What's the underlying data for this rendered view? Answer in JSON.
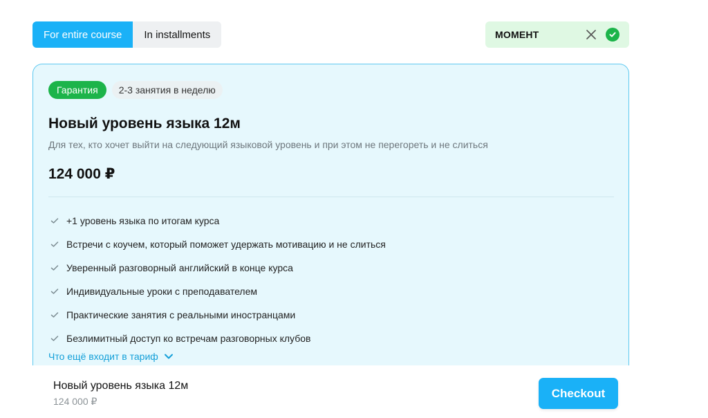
{
  "payment_toggle": {
    "options": [
      "For entire course",
      "In installments"
    ],
    "selected": "For entire course"
  },
  "promo": {
    "code": "МОМЕНТ",
    "status_icon": "check-circle-icon",
    "clear_icon": "close-icon"
  },
  "tariff": {
    "badges": [
      "Гарантия",
      "2-3 занятия в неделю"
    ],
    "title": "Новый уровень языка 12м",
    "subtitle": "Для тех, кто хочет выйти на следующий языковой уровень и при этом не перегореть и не слиться",
    "price": "124 000 ₽",
    "features": [
      "+1 уровень языка по итогам курса",
      "Встречи с коучем, который поможет удержать мотивацию и не слиться",
      "Уверенный разговорный английский в конце курса",
      "Индивидуальные уроки с преподавателем",
      "Практические занятия с реальными иностранцами",
      "Безлимитный доступ ко встречам разговорных клубов"
    ],
    "more_link": "Что ещё входит в тариф"
  },
  "summary": {
    "title": "Новый уровень языка 12м",
    "price": "124 000 ₽",
    "checkout_label": "Checkout"
  },
  "colors": {
    "accent": "#1ab1f7",
    "success": "#1cb44a",
    "card_bg": "#e6f8fd",
    "promo_bg": "#dff8e3",
    "link": "#139fd8"
  }
}
